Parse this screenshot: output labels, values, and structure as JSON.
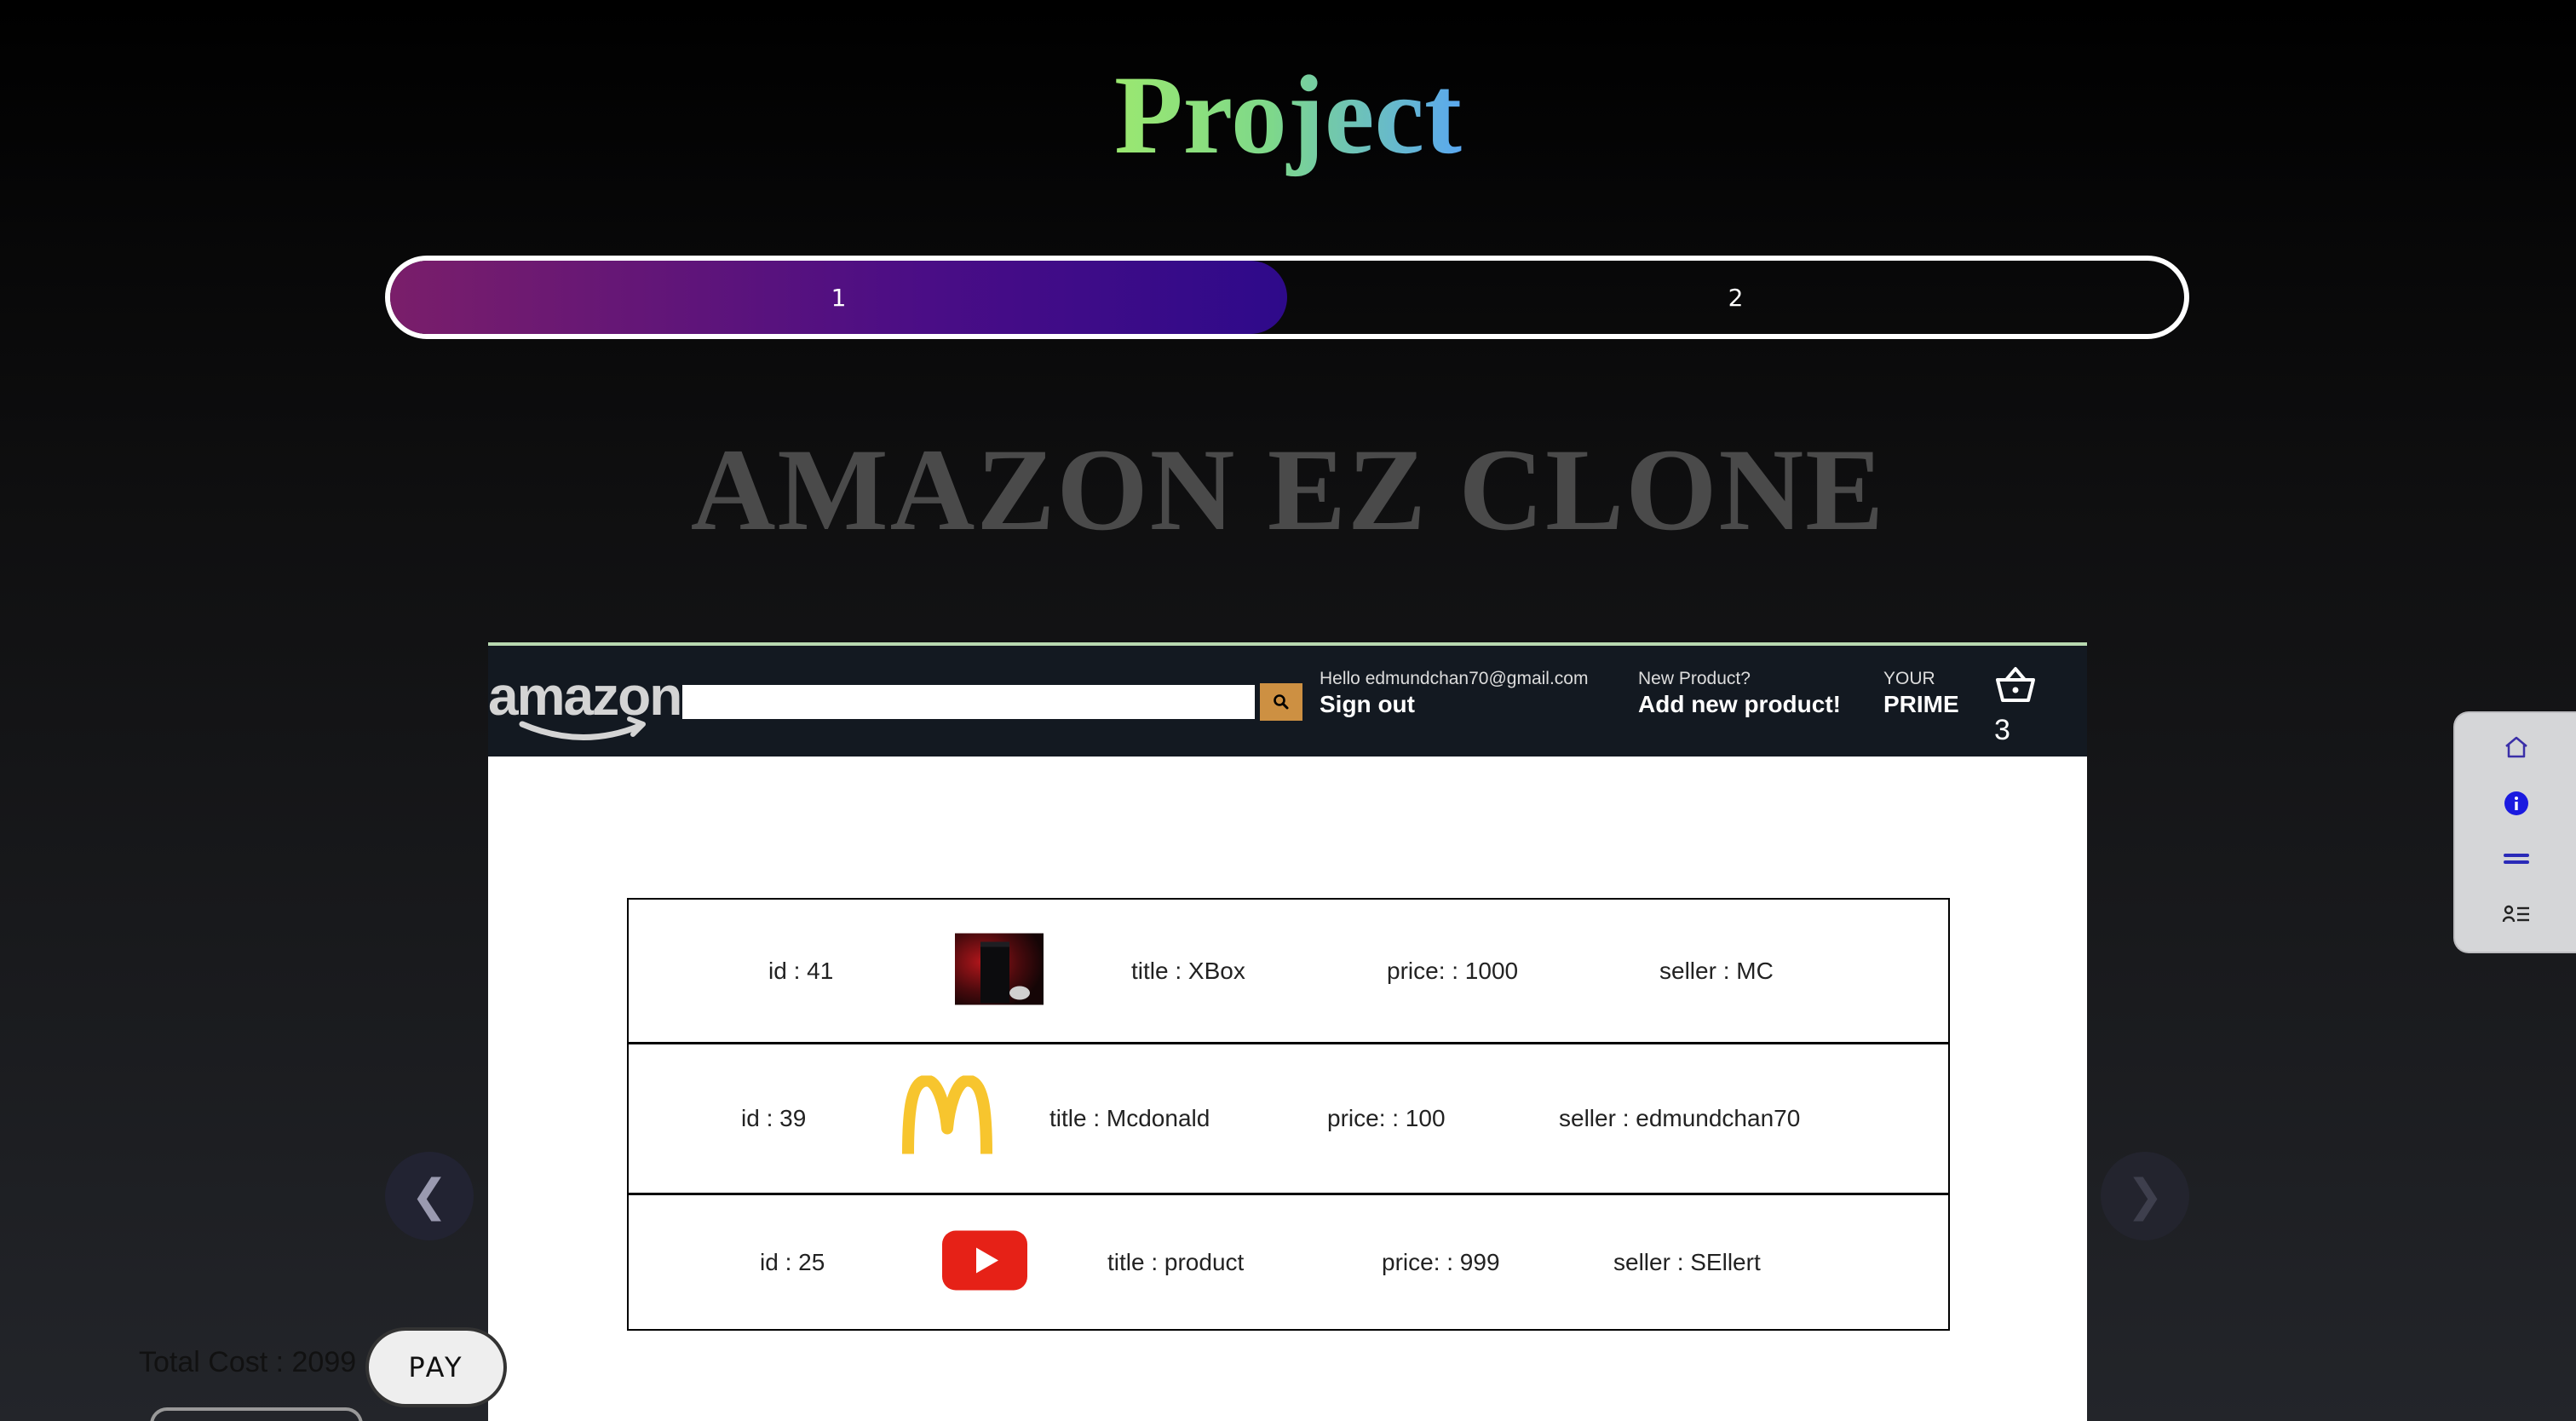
{
  "page": {
    "title": "Project",
    "heading": "AMAZON EZ CLONE"
  },
  "stepper": {
    "steps": [
      "1",
      "2"
    ],
    "active_step": 1,
    "progress_fraction": 0.5,
    "colors": {
      "fill_start": "#7a1e6a",
      "fill_end": "#2e0a8a",
      "border": "#ffffff"
    }
  },
  "amazon": {
    "logo_text": "amazon",
    "search": {
      "value": "",
      "placeholder": ""
    },
    "search_icon": "search-icon",
    "greeting": "Hello edmundchan70@gmail.com",
    "sign_out": "Sign out",
    "new_product_small": "New Product?",
    "new_product_big": "Add new product!",
    "prime_small": "YOUR",
    "prime_big": "PRIME",
    "basket_icon": "basket-icon",
    "basket_count": "3",
    "colors": {
      "nav_bg": "#131921",
      "search_button": "#cd9042"
    }
  },
  "cart": {
    "rows": [
      {
        "id": "id : 41",
        "image": "xbox-image",
        "title": "title : XBox",
        "price": "price: : 1000",
        "seller": "seller : MC"
      },
      {
        "id": "id : 39",
        "image": "mcdonalds-logo",
        "title": "title : Mcdonald",
        "price": "price: : 100",
        "seller": "seller : edmundchan70"
      },
      {
        "id": "id : 25",
        "image": "youtube-logo",
        "title": "title : product",
        "price": "price: : 999",
        "seller": "seller : SEllert"
      }
    ],
    "total": "Total Cost : 2099",
    "pay_label": "PAY"
  },
  "carousel": {
    "prev_label": "❮",
    "next_label": "❯"
  },
  "side_widget": {
    "icons": [
      "home-icon",
      "info-icon",
      "skillshare-icon",
      "user-list-icon"
    ]
  }
}
